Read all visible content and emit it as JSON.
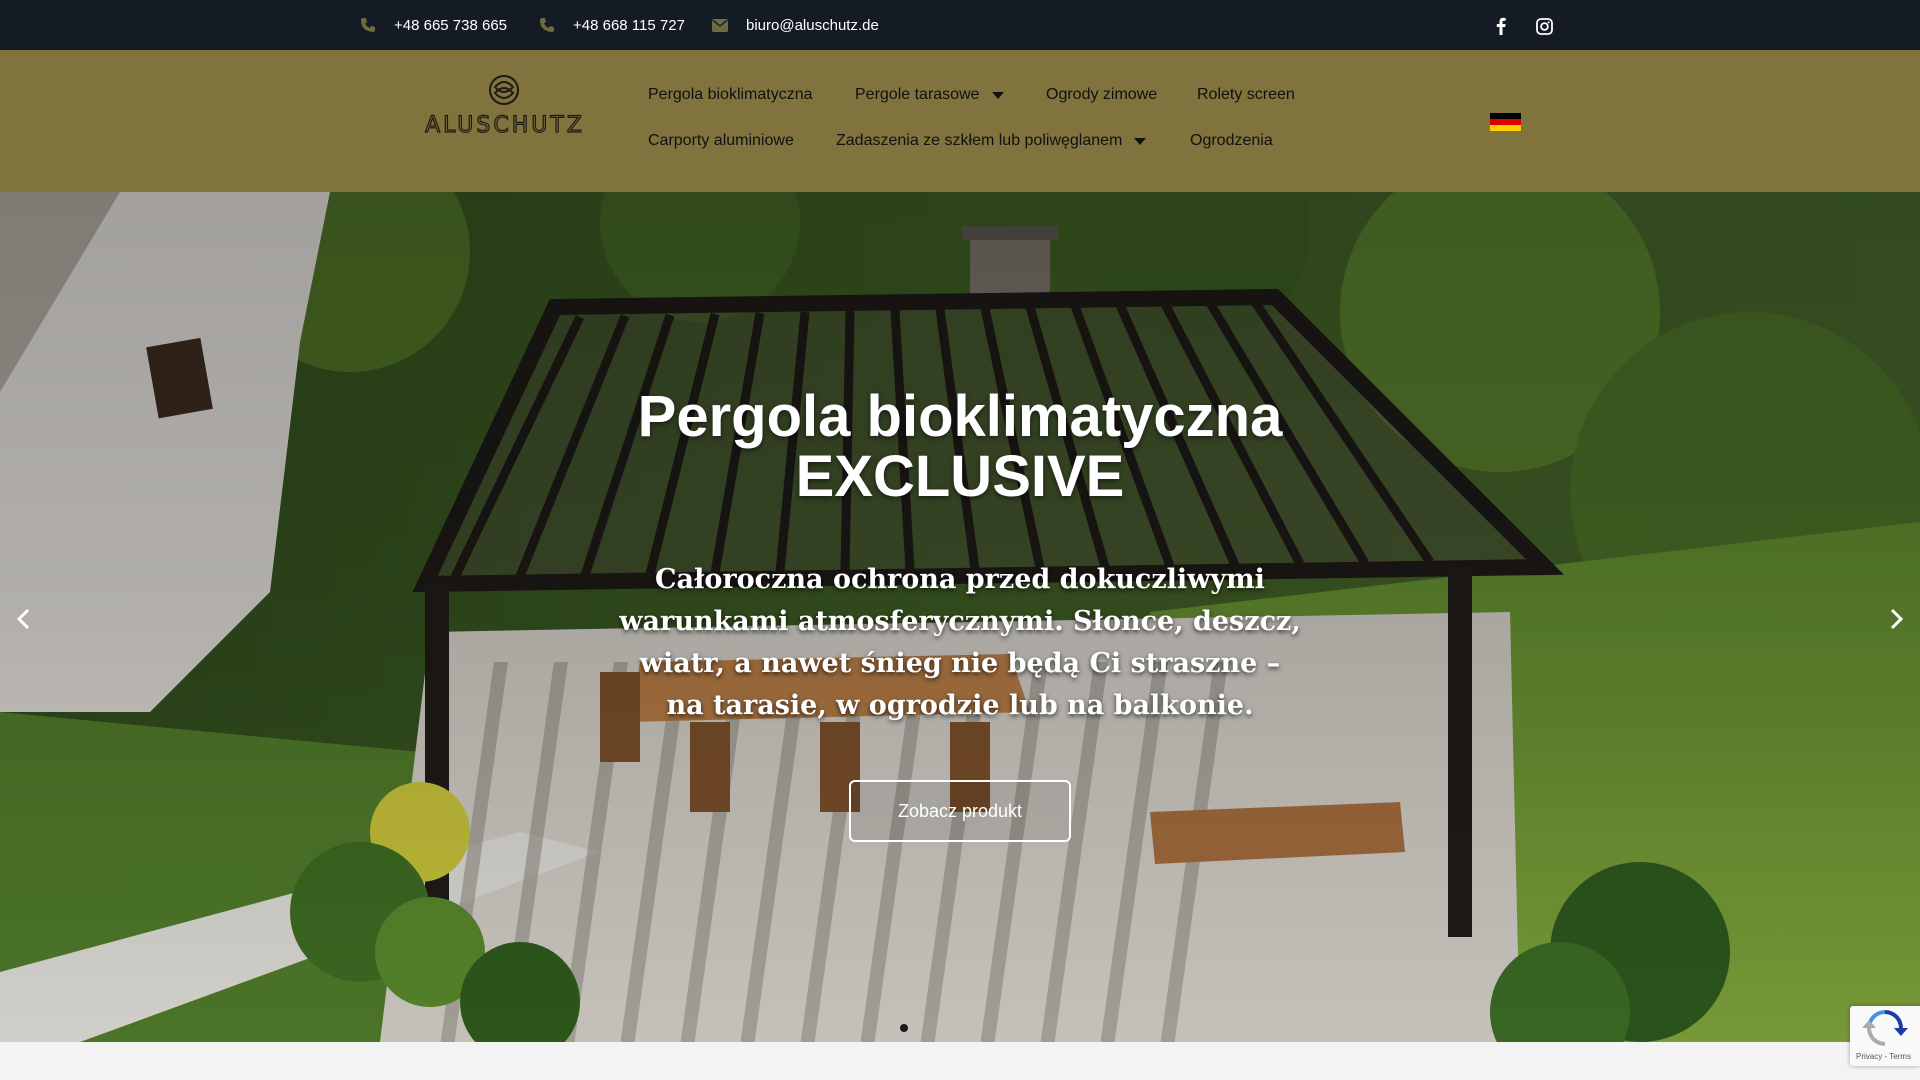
{
  "topbar": {
    "phone1": "+48 665 738 665",
    "phone2": "+48 668 115 727",
    "email": "biuro@aluschutz.de",
    "icons": [
      "phone-icon",
      "phone-icon",
      "envelope-icon",
      "facebook-icon",
      "instagram-icon"
    ]
  },
  "header": {
    "logo_text": "ALUSCHUTZ",
    "nav": [
      {
        "label": "Pergola bioklimatyczna",
        "has_dropdown": false
      },
      {
        "label": "Pergole tarasowe",
        "has_dropdown": true
      },
      {
        "label": "Ogrody zimowe",
        "has_dropdown": false
      },
      {
        "label": "Rolety screen",
        "has_dropdown": false
      },
      {
        "label": "Carporty aluminiowe",
        "has_dropdown": false
      },
      {
        "label": "Zadaszenia ze szkłem lub poliwęglanem",
        "has_dropdown": true
      },
      {
        "label": "Ogrodzenia",
        "has_dropdown": false
      }
    ],
    "language_flag": "german-flag-icon"
  },
  "hero": {
    "title_line1": "Pergola bioklimatyczna",
    "title_line2": "EXCLUSIVE",
    "subtitle_line1": "Całoroczna ochrona przed dokuczliwymi",
    "subtitle_line2": "warunkami atmosferycznymi. Słonce, deszcz,",
    "subtitle_line3": "wiatr, a nawet śnieg nie będą Ci straszne –",
    "subtitle_line4": "na tarasie, w ogrodzie lub na balkonie.",
    "button_label": "Zobacz produkt",
    "active_slide": 1
  },
  "recaptcha": {
    "terms_text": "Privacy - Terms"
  },
  "colors": {
    "topbar_bg": "#141b25",
    "header_bg": "#80733d",
    "text_light": "#ffffff"
  }
}
